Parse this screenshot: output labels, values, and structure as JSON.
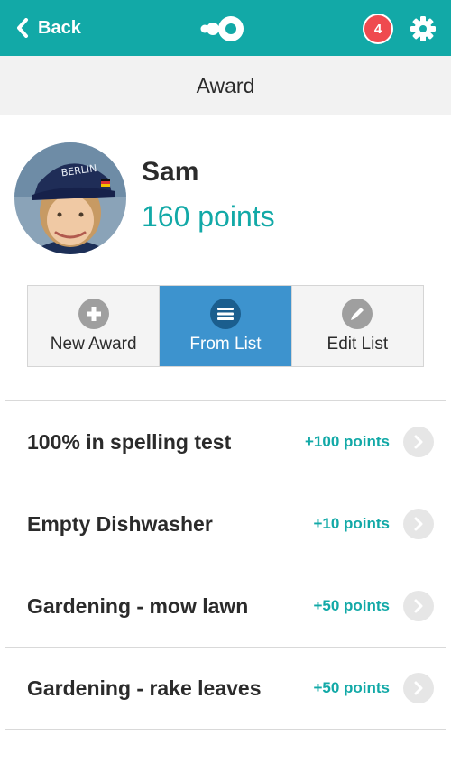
{
  "header": {
    "back_label": "Back",
    "notification_count": "4",
    "accent_color": "#12a9a7",
    "badge_color": "#ef4a4f"
  },
  "page": {
    "title": "Award"
  },
  "profile": {
    "name": "Sam",
    "points": "160 points"
  },
  "segments": [
    {
      "label": "New Award",
      "icon": "plus-circle-icon",
      "active": false
    },
    {
      "label": "From List",
      "icon": "list-icon",
      "active": true
    },
    {
      "label": "Edit List",
      "icon": "pencil-icon",
      "active": false
    }
  ],
  "awards": [
    {
      "title": "100% in spelling test",
      "points": "+100 points"
    },
    {
      "title": "Empty Dishwasher",
      "points": "+10 points"
    },
    {
      "title": "Gardening - mow lawn",
      "points": "+50 points"
    },
    {
      "title": "Gardening - rake leaves",
      "points": "+50 points"
    }
  ]
}
